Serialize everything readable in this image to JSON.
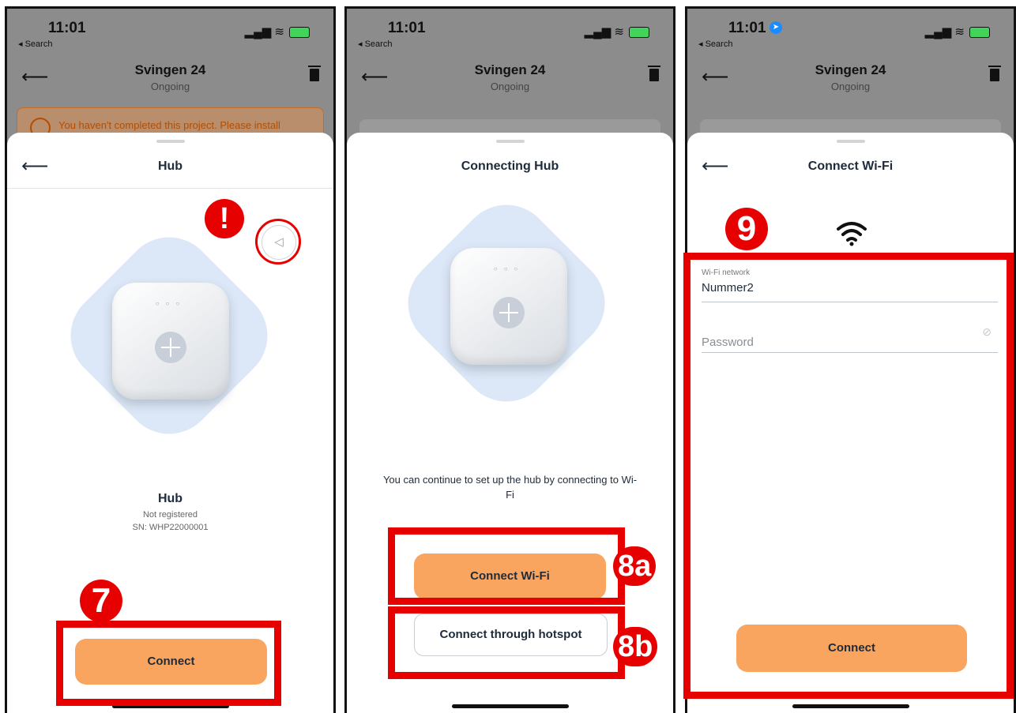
{
  "status_bar": {
    "time": "11:01",
    "back_label": "◂ Search"
  },
  "project": {
    "title": "Svingen 24",
    "status": "Ongoing"
  },
  "warning_text": "You haven't completed this project. Please install",
  "screen1": {
    "title": "Hub",
    "device_name": "Hub",
    "registration": "Not registered",
    "serial": "SN: WHP22000001",
    "connect_button": "Connect",
    "badge_step": "7",
    "badge_alert": "!"
  },
  "screen2": {
    "title": "Connecting Hub",
    "message": "You can continue to set up the hub by connecting to Wi-Fi",
    "wifi_button": "Connect Wi-Fi",
    "hotspot_button": "Connect through hotspot",
    "badge_a": "8a",
    "badge_b": "8b"
  },
  "screen3": {
    "title": "Connect Wi-Fi",
    "network_label": "Wi-Fi network",
    "network_value": "Nummer2",
    "password_placeholder": "Password",
    "connect_button": "Connect",
    "badge_step": "9"
  },
  "colors": {
    "accent": "#f9a45f",
    "annotation": "#e60000",
    "hub_halo": "#dce8f8"
  },
  "icons": [
    "back-arrow-icon",
    "trash-icon",
    "speaker-icon",
    "wifi-icon",
    "eye-off-icon",
    "location-icon"
  ]
}
